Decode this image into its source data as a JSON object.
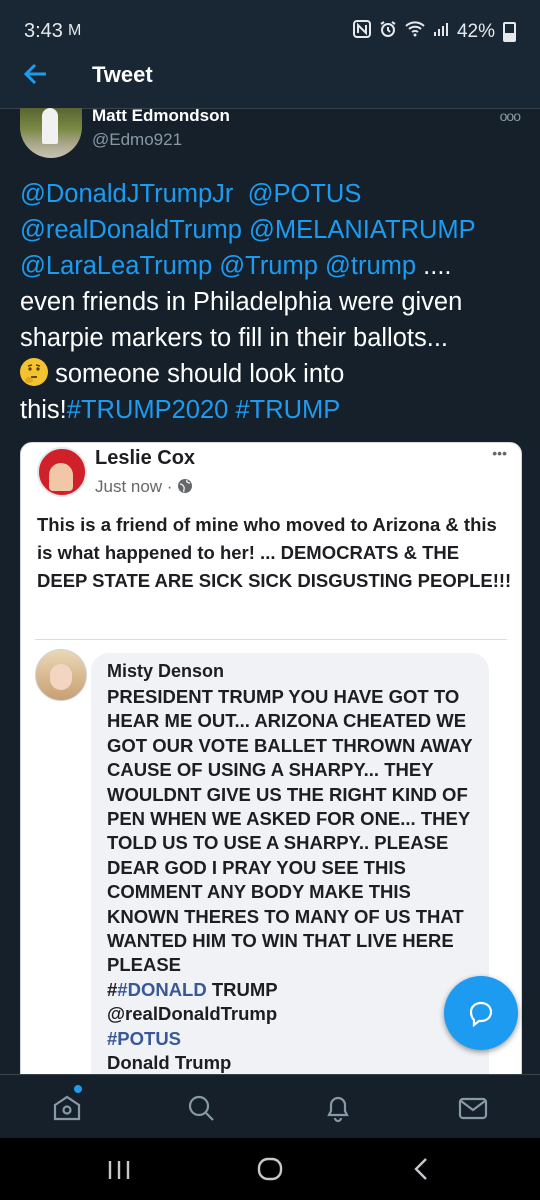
{
  "status_bar": {
    "time": "3:43",
    "mail_icon": "M",
    "icons": [
      "nfc-icon",
      "alarm-icon",
      "wifi-icon",
      "signal-icon"
    ],
    "battery": "42%"
  },
  "header": {
    "title": "Tweet"
  },
  "tweet": {
    "author_name": "Matt Edmondson",
    "author_handle": "@Edmo921",
    "more_icon": "ooo",
    "mentions_line1": [
      "@DonaldJTrumpJr",
      "@POTUS"
    ],
    "mentions_line2": [
      "@realDonaldTrump",
      "@MELANIATRUMP"
    ],
    "mentions_line3": [
      "@LaraLeaTrump",
      "@Trump",
      "@trump"
    ],
    "text_after_mentions": " ....",
    "text_main": "even friends in Philadelphia were given sharpie markers to fill in their ballots...",
    "text_after_emoji": " someone should look into this!",
    "hashtags": [
      "#TRUMP2020",
      "#TRUMP"
    ]
  },
  "embedded_post": {
    "more_icon": "•••",
    "author": "Leslie Cox",
    "time": "Just now ·",
    "text": "This is a friend of mine who moved to Arizona & this is what happened to her! ... DEMOCRATS & THE DEEP STATE ARE SICK SICK DISGUSTING PEOPLE!!!",
    "comment": {
      "author": "Misty Denson",
      "text": "PRESIDENT TRUMP YOU HAVE GOT TO HEAR ME OUT... ARIZONA CHEATED WE GOT OUR VOTE BALLET THROWN AWAY CAUSE OF USING A SHARPY... THEY WOULDNT GIVE US THE RIGHT KIND OF PEN WHEN WE ASKED FOR ONE... THEY TOLD US TO USE A SHARPY.. PLEASE DEAR GOD I PRAY YOU SEE THIS COMMENT ANY BODY MAKE THIS KNOWN THERES TO MANY OF US THAT WANTED HIM TO WIN THAT LIVE HERE PLEASE",
      "hash_prefix": "#",
      "tag1": "#DONALD",
      "tag1_after": " TRUMP",
      "mention": "@realDonaldTrump",
      "tag2": "#POTUS",
      "last_line": "Donald Trump"
    }
  },
  "colors": {
    "background": "#15202b",
    "accent": "#1d9bf0",
    "muted": "#8899a6"
  }
}
